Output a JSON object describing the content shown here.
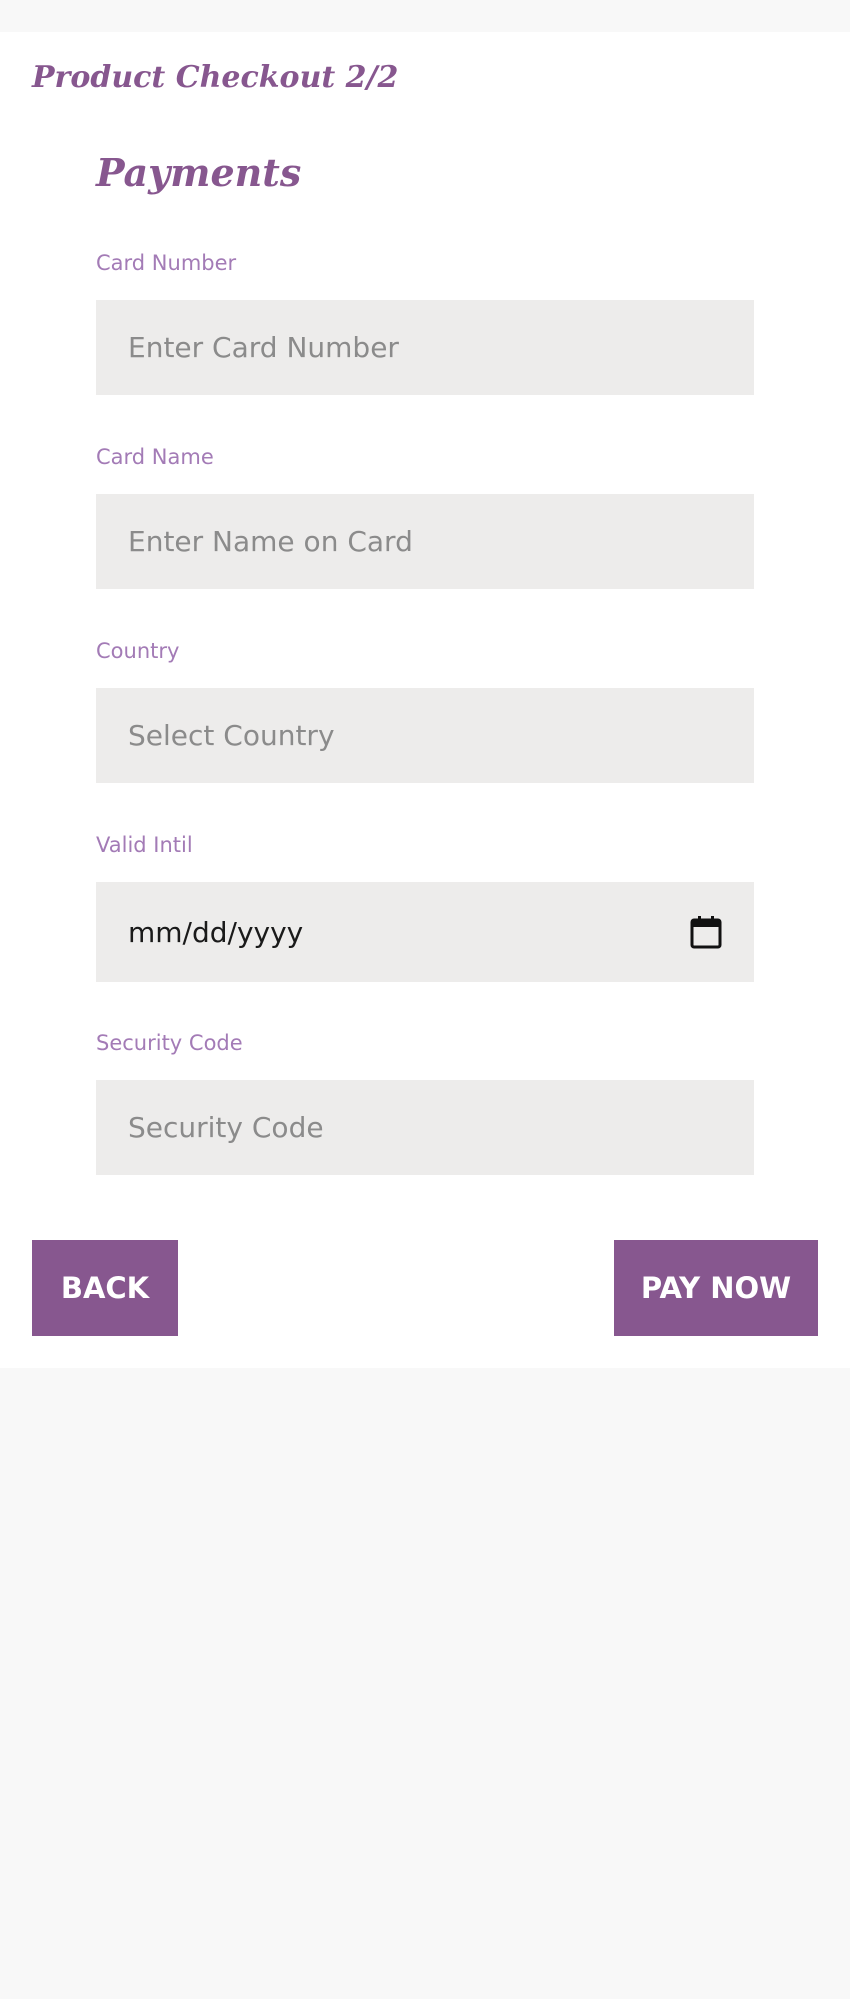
{
  "header": {
    "title": "Product Checkout 2/2"
  },
  "form": {
    "section_title": "Payments",
    "card_number": {
      "label": "Card Number",
      "placeholder": "Enter Card Number"
    },
    "card_name": {
      "label": "Card Name",
      "placeholder": "Enter Name on Card"
    },
    "country": {
      "label": "Country",
      "placeholder": "Select Country"
    },
    "valid_until": {
      "label": "Valid Intil",
      "value": "mm/dd/yyyy",
      "icon": "calendar-icon"
    },
    "security_code": {
      "label": "Security Code",
      "placeholder": "Security Code"
    }
  },
  "actions": {
    "back_label": "BACK",
    "pay_label": "PAY NOW"
  },
  "colors": {
    "accent": "#87578f",
    "label": "#a37bb6",
    "field_bg": "#edeceb",
    "page_bg": "#f8f8f8",
    "card_bg": "#ffffff"
  }
}
